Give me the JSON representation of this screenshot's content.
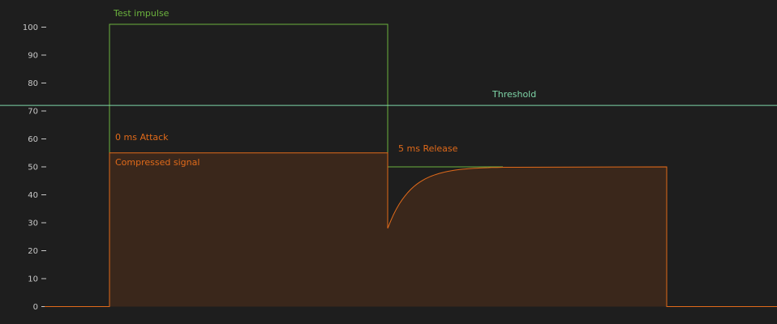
{
  "chart_data": {
    "type": "area",
    "title": "",
    "xlabel": "",
    "ylabel": "",
    "ylim": [
      0,
      100
    ],
    "yticks": [
      0,
      10,
      20,
      30,
      40,
      50,
      60,
      70,
      80,
      90,
      100
    ],
    "grid": false,
    "threshold": 72,
    "test_impulse": {
      "level": 101
    },
    "compressed_signal": {
      "attack_level": 55,
      "dip_level": 28,
      "release_level": 50,
      "baseline": 0
    },
    "annotations": {
      "test_impulse": "Test impulse",
      "threshold": "Threshold",
      "attack": "0 ms Attack",
      "compressed": "Compressed signal",
      "release": "5 ms Release"
    },
    "colors": {
      "background": "#1e1e1e",
      "impulse": "#6cb33e",
      "threshold": "#7fd6a8",
      "compressed": "#e06a1a",
      "compressed_fill": "#3a271b",
      "axis_text": "#c8c8c8"
    }
  }
}
